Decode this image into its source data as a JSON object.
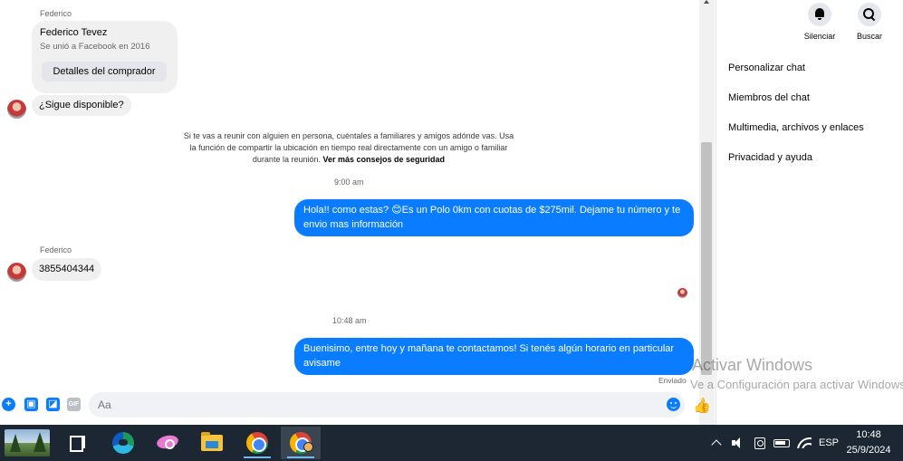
{
  "chat": {
    "sender_label_1": "Federico",
    "profile_card": {
      "name": "Federico Tevez",
      "subtitle": "Se unió a Facebook en 2016",
      "button_label": "Detalles del comprador"
    },
    "message_1": "¿Sigue disponible?",
    "safety_notice": "Si te vas a reunir con alguien en persona, cuéntales a familiares y amigos adónde vas. Usa la función de compartir la ubicación en tiempo real directamente con un amigo o familiar durante la reunión.",
    "safety_link": "Ver más consejos de seguridad",
    "timestamp_1": "9:00 am",
    "outgoing_1": "Hola!! como estas? 😊Es un Polo 0km con cuotas de $275mil. Dejame tu número y te envio mas información",
    "sender_label_2": "Federico",
    "message_2": "3855404344",
    "timestamp_2": "10:48 am",
    "outgoing_2": "Buenisimo, entre hoy y mañana te contactamos! Si tenés algún horario en particular avisame",
    "sent_status": "Enviado"
  },
  "composer": {
    "placeholder": "Aa",
    "icons": [
      "plus-icon",
      "image-icon",
      "sticker-icon",
      "gif-icon",
      "emoji-icon",
      "thumbs-up-icon"
    ],
    "gif_label": "GIF"
  },
  "right_panel": {
    "mute_label": "Silenciar",
    "search_label": "Buscar",
    "menu": [
      "Personalizar chat",
      "Miembros del chat",
      "Multimedia, archivos y enlaces",
      "Privacidad y ayuda"
    ]
  },
  "watermark": {
    "line1": "Activar Windows",
    "line2": "Ve a Configuración para activar Windows."
  },
  "taskbar": {
    "apps": [
      "start-button",
      "task-view",
      "microsoft-edge",
      "snipping-tool",
      "file-explorer",
      "google-chrome",
      "google-chrome-profile"
    ],
    "language": "ESP",
    "time": "10:48",
    "date": "25/9/2024"
  },
  "colors": {
    "outgoing_bubble": "#0a7cff",
    "incoming_bubble": "#f0f0f0",
    "taskbar": "#1c2733"
  }
}
